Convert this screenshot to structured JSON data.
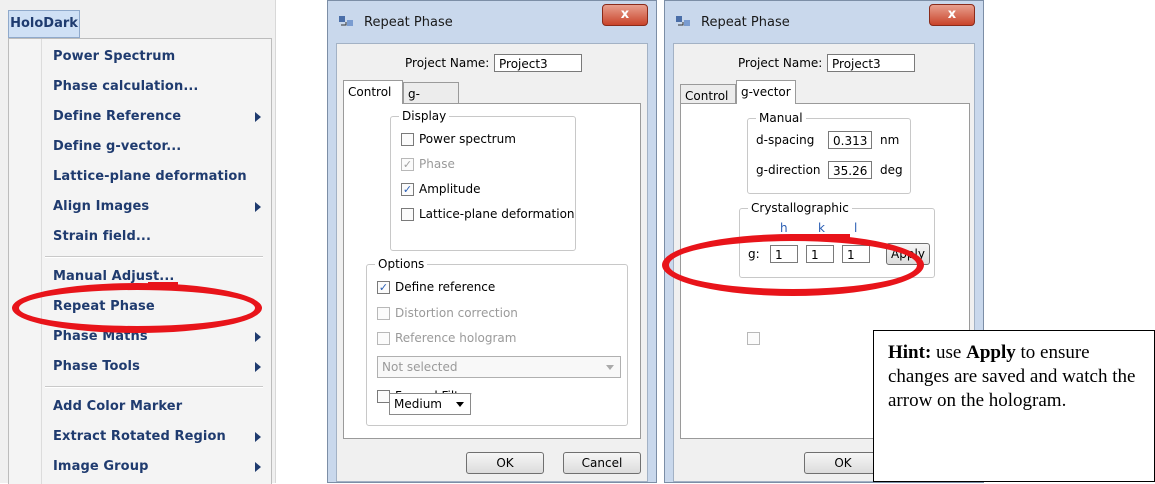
{
  "menu": {
    "title": "HoloDark",
    "items": [
      {
        "label": "Power Spectrum",
        "submenu": false
      },
      {
        "label": "Phase calculation...",
        "submenu": false
      },
      {
        "label": "Define Reference",
        "submenu": true
      },
      {
        "label": "Define g-vector...",
        "submenu": false
      },
      {
        "label": "Lattice-plane deformation",
        "submenu": false
      },
      {
        "label": "Align Images",
        "submenu": true
      },
      {
        "label": "Strain field...",
        "submenu": false
      },
      {
        "label": "Manual Adjust...",
        "submenu": false
      },
      {
        "label": "Repeat Phase",
        "submenu": false
      },
      {
        "label": "Phase Maths",
        "submenu": true
      },
      {
        "label": "Phase Tools",
        "submenu": true
      },
      {
        "label": "Add Color Marker",
        "submenu": false
      },
      {
        "label": "Extract Rotated Region",
        "submenu": true
      },
      {
        "label": "Image Group",
        "submenu": true
      }
    ]
  },
  "dialog1": {
    "title": "Repeat Phase",
    "close": "x",
    "project_label": "Project Name:",
    "project_value": "Project3",
    "tabs": [
      "Control",
      "g-vector"
    ],
    "display": {
      "title": "Display",
      "options": [
        {
          "label": "Power spectrum",
          "checked": false,
          "enabled": true
        },
        {
          "label": "Phase",
          "checked": true,
          "enabled": false
        },
        {
          "label": "Amplitude",
          "checked": true,
          "enabled": true
        },
        {
          "label": "Lattice-plane deformation",
          "checked": false,
          "enabled": true
        }
      ]
    },
    "options_group": {
      "title": "Options",
      "define_reference": "Define reference",
      "distortion_correction": "Distortion correction",
      "reference_hologram": "Reference hologram",
      "select_value": "Not selected",
      "fresnel_filter": "Fresnel Filter",
      "fresnel_level": "Medium"
    },
    "ok": "OK",
    "cancel": "Cancel",
    "check_mark": "✓"
  },
  "dialog2": {
    "title": "Repeat Phase",
    "close": "x",
    "project_label": "Project Name:",
    "project_value": "Project3",
    "tabs": [
      "Control",
      "g-vector"
    ],
    "manual": {
      "title": "Manual",
      "d_spacing_label": "d-spacing",
      "d_spacing_value": "0.313",
      "d_spacing_unit": "nm",
      "g_direction_label": "g-direction",
      "g_direction_value": "35.26",
      "g_direction_unit": "deg"
    },
    "crystallographic": {
      "title": "Crystallographic",
      "h": "h",
      "k": "k",
      "l": "l",
      "g_label": "g:",
      "h_value": "1",
      "k_value": "1",
      "l_value": "1",
      "apply": "Apply"
    },
    "ok": "OK"
  },
  "hint": {
    "bold1": "Hint:",
    "text1": " use ",
    "bold2": "Apply",
    "text2": " to ensure changes are saved and watch the arrow on the hologram."
  },
  "colors": {
    "annotation": "#e8141a",
    "menu_text": "#1f3b6f"
  }
}
